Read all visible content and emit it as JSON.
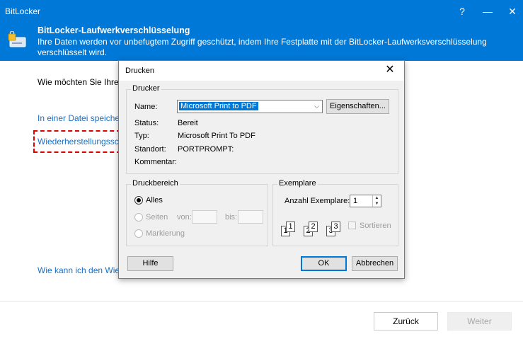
{
  "window": {
    "title": "BitLocker",
    "controls": {
      "help": "?",
      "minimize": "—",
      "close": "✕"
    }
  },
  "header": {
    "icon": "bitlocker-drive-icon",
    "title": "BitLocker-Laufwerkverschlüsselung",
    "description": "Ihre Daten werden vor unbefugtem Zugriff geschützt, indem Ihre Festplatte mit der BitLocker-Laufwerksverschlüsselung verschlüsselt wird."
  },
  "content": {
    "question": "Wie möchten Sie Ihre",
    "link_save": "In einer Datei speiche",
    "link_recovery": "Wiederherstellungssc",
    "link_how": "Wie kann ich den Wie"
  },
  "footer": {
    "back": "Zurück",
    "next": "Weiter"
  },
  "print_dialog": {
    "title": "Drucken",
    "close": "✕",
    "printer_group": "Drucker",
    "name_label": "Name:",
    "printer_name": "Microsoft Print to PDF",
    "properties_button": "Eigenschaften...",
    "status_label": "Status:",
    "status_value": "Bereit",
    "type_label": "Typ:",
    "type_value": "Microsoft Print To PDF",
    "location_label": "Standort:",
    "location_value": "PORTPROMPT:",
    "comment_label": "Kommentar:",
    "comment_value": "",
    "range_group": "Druckbereich",
    "range_all": "Alles",
    "range_pages": "Seiten",
    "from_label": "von:",
    "to_label": "bis:",
    "range_selection": "Markierung",
    "copies_group": "Exemplare",
    "copies_label": "Anzahl Exemplare:",
    "copies_value": "1",
    "collate_label": "Sortieren",
    "collate_pages": [
      "1",
      "1",
      "2",
      "2",
      "3",
      "3"
    ],
    "help_button": "Hilfe",
    "ok_button": "OK",
    "cancel_button": "Abbrechen"
  }
}
